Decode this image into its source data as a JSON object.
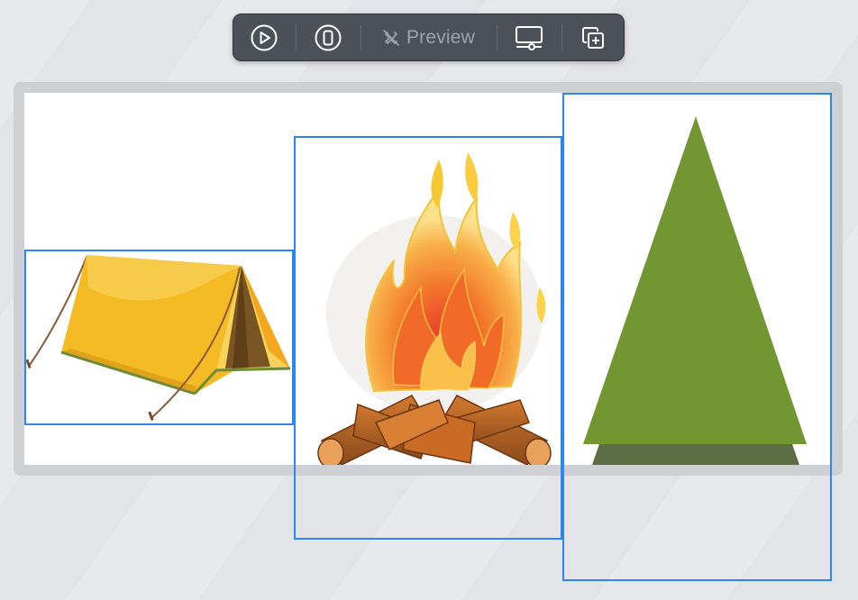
{
  "toolbar": {
    "play_icon": "play-circle-icon",
    "device_icon": "device-icon",
    "preview_icon": "preview-disabled-icon",
    "preview_label": "Preview",
    "display_settings_icon": "display-settings-icon",
    "duplicate_icon": "duplicate-plus-icon"
  },
  "canvas": {
    "views": [
      {
        "name": "tent-image",
        "selected": true
      },
      {
        "name": "campfire-image",
        "selected": true
      },
      {
        "name": "tree-image",
        "selected": true
      }
    ]
  },
  "colors": {
    "selection": "#2a86f0",
    "toolbar_bg": "#4c5058",
    "tree_green": "#729632",
    "tree_shadow": "#5c6c44",
    "tent_yellow": "#f4bb24"
  }
}
